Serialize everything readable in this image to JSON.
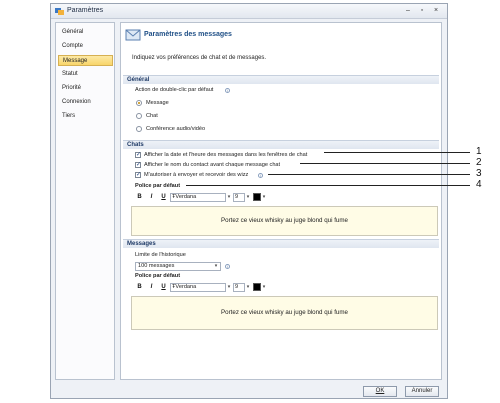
{
  "window": {
    "title": "Paramètres"
  },
  "sidebar": {
    "items": [
      {
        "label": "Général"
      },
      {
        "label": "Compte"
      },
      {
        "label": "Message"
      },
      {
        "label": "Statut"
      },
      {
        "label": "Priorité"
      },
      {
        "label": "Connexion"
      },
      {
        "label": "Tiers"
      }
    ],
    "selected": "Message"
  },
  "header": {
    "title": "Paramètres des messages",
    "subtitle": "Indiquez vos préférences de chat et de messages."
  },
  "general": {
    "section": "Général",
    "double_click_label": "Action de double-clic par défaut",
    "options": [
      "Message",
      "Chat",
      "Conférence audio/vidéo"
    ],
    "selected": "Message"
  },
  "chats": {
    "section": "Chats",
    "checkboxes": [
      {
        "label": "Afficher la date et l'heure des messages dans les fenêtres de chat",
        "checked": true
      },
      {
        "label": "Afficher le nom du contact avant chaque message chat",
        "checked": true
      },
      {
        "label": "M'autoriser à envoyer et recevoir des wizz",
        "checked": true
      }
    ],
    "font_label": "Police par défaut",
    "toolbar": {
      "bold": "B",
      "italic": "I",
      "underline": "U",
      "font": "Verdana",
      "size": "9"
    },
    "preview": "Portez ce vieux whisky au juge blond qui fume"
  },
  "messages": {
    "section": "Messages",
    "history_label": "Limite de l'historique",
    "history_value": "100 messages",
    "font_label": "Police par défaut",
    "toolbar": {
      "bold": "B",
      "italic": "I",
      "underline": "U",
      "font": "Verdana",
      "size": "9"
    },
    "preview": "Portez ce vieux whisky au juge blond qui fume"
  },
  "footer": {
    "ok": "OK",
    "cancel": "Annuler"
  },
  "callouts": [
    "1",
    "2",
    "3",
    "4"
  ],
  "colors": {
    "accent": "#1f4f86",
    "selection": "#f8d56a",
    "preview_bg": "#fffce6"
  }
}
